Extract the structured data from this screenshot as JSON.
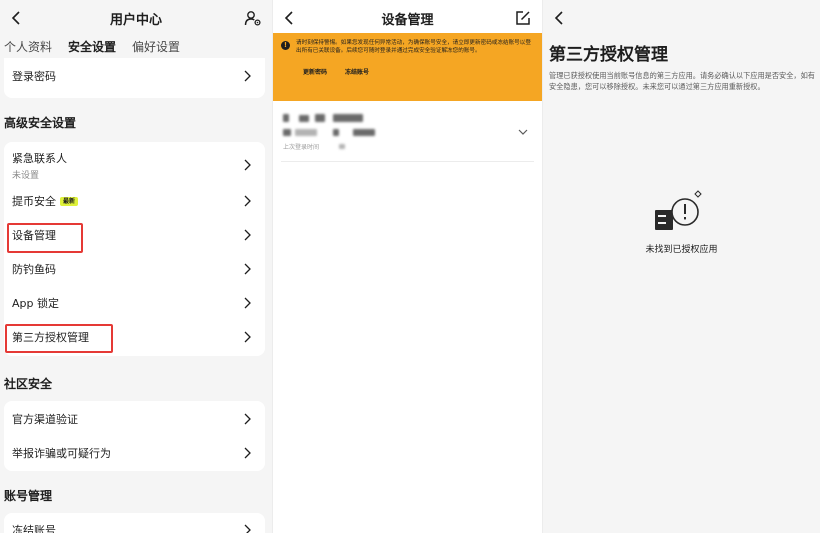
{
  "panel1": {
    "title": "用户中心",
    "tabs": [
      "个人资料",
      "安全设置",
      "偏好设置"
    ],
    "login_password": "登录密码",
    "advanced": {
      "title": "高级安全设置",
      "emergency_contact": "紧急联系人",
      "emergency_contact_status": "未设置",
      "withdraw_security": "提币安全",
      "withdraw_badge": "最新",
      "device_management": "设备管理",
      "anti_phishing": "防钓鱼码",
      "app_lock": "App 锁定",
      "third_party": "第三方授权管理"
    },
    "community": {
      "title": "社区安全",
      "official_verify": "官方渠道验证",
      "report_fraud": "举报诈骗或可疑行为"
    },
    "account": {
      "title": "账号管理",
      "freeze": "冻结账号"
    }
  },
  "panel2": {
    "title": "设备管理",
    "warning": "请时刻保持警惕。如果您发现任何异常活动，为确保账号安全，请立即更新密码或冻结账号以登出所有已关联设备。后续您可随时登录并通过完成安全验证解冻您的账号。",
    "update_password": "更新密码",
    "freeze_account": "冻结账号",
    "device_last": "上次登录时间"
  },
  "panel3": {
    "title": "第三方授权管理",
    "description": "管理已获授权使用当前账号信息的第三方应用。请务必确认以下应用是否安全，如有安全隐患，您可以移除授权。未来您可以通过第三方应用重新授权。",
    "empty": "未找到已授权应用"
  },
  "colors": {
    "banner": "#f5a623",
    "highlight": "#e53935",
    "badge": "#dff23a"
  },
  "icons": {
    "back": "chevron-left-icon",
    "profile_settings": "user-settings-icon",
    "edit": "edit-icon",
    "row_arrow": "chevron-right-icon",
    "warning": "warning-icon",
    "expand": "chevron-down-icon",
    "empty": "empty-state-icon"
  }
}
